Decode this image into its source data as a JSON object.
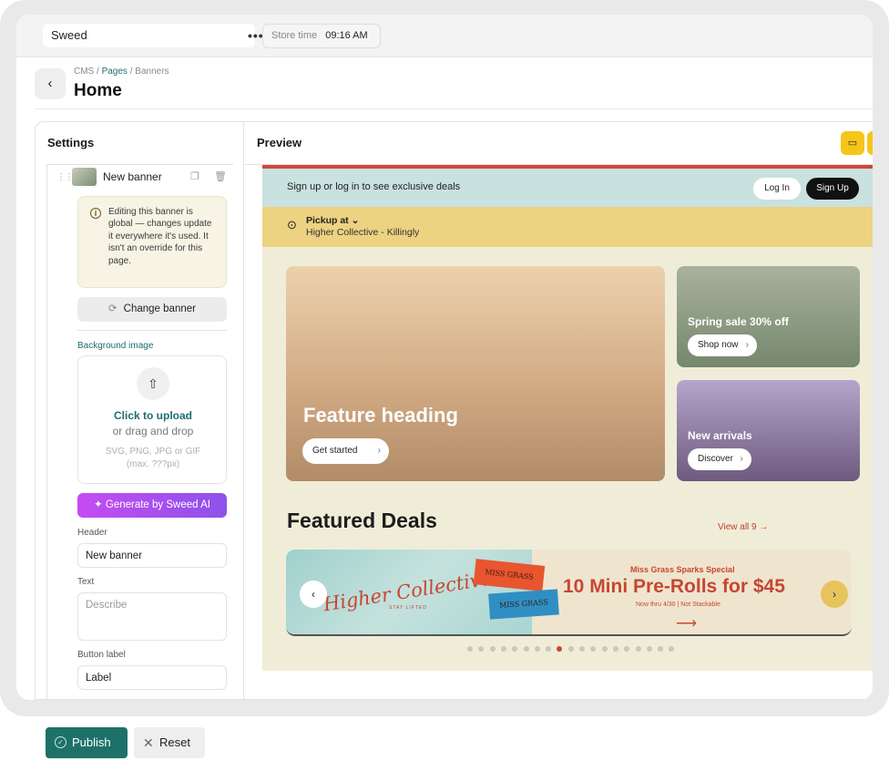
{
  "topbar": {
    "store": "Sweed",
    "menu_icon": "more-dots-icon",
    "store_time_label": "Store time",
    "store_time_value": "09:16 AM"
  },
  "breadcrumb": {
    "cms": "CMS",
    "sep1": " / ",
    "pages": "Pages",
    "sep2": " / ",
    "banners": "Banners"
  },
  "page_title": "Home",
  "settings": {
    "title": "Settings",
    "banner_name": "New banner",
    "note": "Editing this banner is global — changes update it everywhere it's used. It isn't an override for this page.",
    "change_banner": "Change banner",
    "background_image_label": "Background image",
    "upload_cta": "Click to upload",
    "upload_drag": "or drag and drop",
    "upload_hint": "SVG, PNG, JPG or GIF (max. ???px)",
    "ai_button": "Generate by Sweed AI",
    "header_label": "Header",
    "header_value": "New banner",
    "text_label": "Text",
    "text_placeholder": "Describe",
    "button_label_label": "Button label",
    "button_label_value": "Label"
  },
  "preview": {
    "title": "Preview",
    "device_icon": "laptop-icon",
    "promo_text": "Sign up or log in to see exclusive deals",
    "login": "Log In",
    "signup": "Sign Up",
    "pickup_label": "Pickup at",
    "pickup_location": "Higher Collective - Killingly",
    "hero_heading": "Feature heading",
    "hero_button": "Get started",
    "card1_heading": "Spring sale 30% off",
    "card1_button": "Shop now",
    "card2_heading": "New arrivals",
    "card2_button": "Discover",
    "deals_title": "Featured Deals",
    "view_all": "View all 9",
    "carousel": {
      "brand_script": "Higher Collective",
      "brand_tagline": "STAY LIFTED",
      "ticket1": "MISS GRASS",
      "ticket2": "MISS GRASS",
      "special": "Miss Grass Sparks Special",
      "headline": "10 Mini Pre-Rolls for $45",
      "fine_print": "Now thru 4/30 | Not Stackable",
      "arrow": "⟶"
    },
    "dot_count": 19,
    "active_dot": 8
  },
  "actions": {
    "publish": "Publish",
    "reset": "Reset"
  },
  "colors": {
    "accent": "#1e7169",
    "promo_bg": "#c9e1df",
    "pickup_bg": "#ecd281",
    "site_bg": "#efedd8",
    "deal_red": "#c74632",
    "device_toggle": "#f5c518",
    "ai_gradient_start": "#c54bf3",
    "ai_gradient_end": "#8d52ea"
  }
}
